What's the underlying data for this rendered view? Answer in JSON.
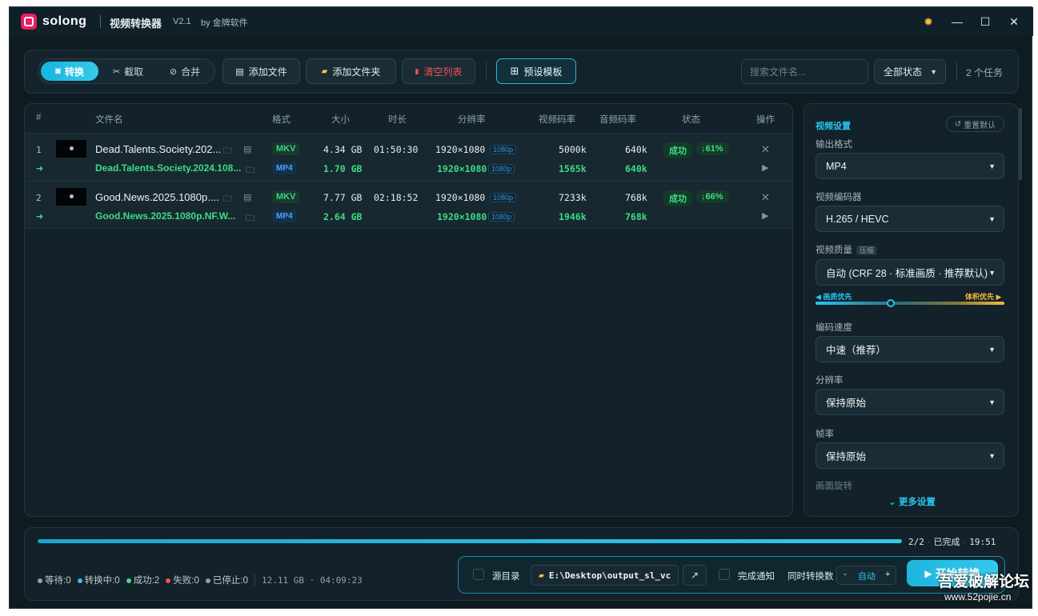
{
  "titlebar": {
    "brand": "solong",
    "app_title": "视频转换器",
    "version": "V2.1",
    "by": "by 金牌软件",
    "theme_icon": "sun-icon",
    "min_icon": "minimize-icon",
    "max_icon": "maximize-icon",
    "close_icon": "close-icon"
  },
  "toolbar": {
    "modes": [
      {
        "label": "转换",
        "icon": "convert-icon",
        "active": true
      },
      {
        "label": "截取",
        "icon": "scissors-icon",
        "active": false
      },
      {
        "label": "合并",
        "icon": "link-icon",
        "active": false
      }
    ],
    "add_file": "添加文件",
    "add_folder": "添加文件夹",
    "clear_list": "清空列表",
    "preset": "预设模板",
    "search_placeholder": "搜索文件名...",
    "status_filter": "全部状态",
    "task_count": "2 个任务"
  },
  "table": {
    "headers": [
      "#",
      "文件名",
      "格式",
      "大小",
      "时长",
      "分辨率",
      "视频码率",
      "音频码率",
      "状态",
      "操作"
    ],
    "rows": [
      {
        "index": "1",
        "name": "Dead.Talents.Society.202...",
        "out_name": "Dead.Talents.Society.2024.108...",
        "format": "MKV",
        "out_format": "MP4",
        "size": "4.34 GB",
        "out_size": "1.70 GB",
        "duration": "01:50:30",
        "resolution": "1920×1080",
        "out_resolution": "1920×1080",
        "res_tag": "1080p",
        "vbitrate": "5000k",
        "out_vbitrate": "1565k",
        "abitrate": "640k",
        "out_abitrate": "640k",
        "status": "成功",
        "reduction": "↓61%"
      },
      {
        "index": "2",
        "name": "Good.News.2025.1080p....",
        "out_name": "Good.News.2025.1080p.NF.W...",
        "format": "MKV",
        "out_format": "MP4",
        "size": "7.77 GB",
        "out_size": "2.64 GB",
        "duration": "02:18:52",
        "resolution": "1920×1080",
        "out_resolution": "1920×1080",
        "res_tag": "1080p",
        "vbitrate": "7233k",
        "out_vbitrate": "1946k",
        "abitrate": "768k",
        "out_abitrate": "768k",
        "status": "成功",
        "reduction": "↓66%"
      }
    ]
  },
  "settings": {
    "title": "视频设置",
    "reset": "重置默认",
    "output_format_label": "输出格式",
    "output_format": "MP4",
    "encoder_label": "视频编码器",
    "encoder": "H.265 / HEVC",
    "quality_label": "视频质量",
    "quality_tag": "压缩",
    "quality": "自动 (CRF 28 · 标准画质 · 推荐默认)",
    "quality_left": "◀ 画质优先",
    "quality_right": "体积优先 ▶",
    "quality_level": 0.4,
    "speed_label": "编码速度",
    "speed": "中速（推荐）",
    "resolution_label": "分辨率",
    "resolution": "保持原始",
    "framerate_label": "帧率",
    "framerate": "保持原始",
    "rotate_label": "画面旋转",
    "more": "更多设置"
  },
  "bottom": {
    "progress": 1.0,
    "progress_count": "2/2",
    "progress_status": "已完成",
    "progress_time": "19:51",
    "stats": [
      {
        "label": "等待:0",
        "color": "#8fa1a9"
      },
      {
        "label": "转换中:0",
        "color": "#29c5f0"
      },
      {
        "label": "成功:2",
        "color": "#3ddc84"
      },
      {
        "label": "失败:0",
        "color": "#ef5350"
      },
      {
        "label": "已停止:0",
        "color": "#8fa1a9"
      }
    ],
    "total_size": "12.11 GB · 04:09:23",
    "source_dir": "源目录",
    "output_path": "E:\\Desktop\\output_sl_vc",
    "notify": "完成通知",
    "concurrency_label": "同时转换数",
    "concurrency": "自动",
    "start": "开始转换"
  },
  "watermark": {
    "line1": "吾爱破解论坛",
    "line2": "www.52pojie.cn"
  }
}
